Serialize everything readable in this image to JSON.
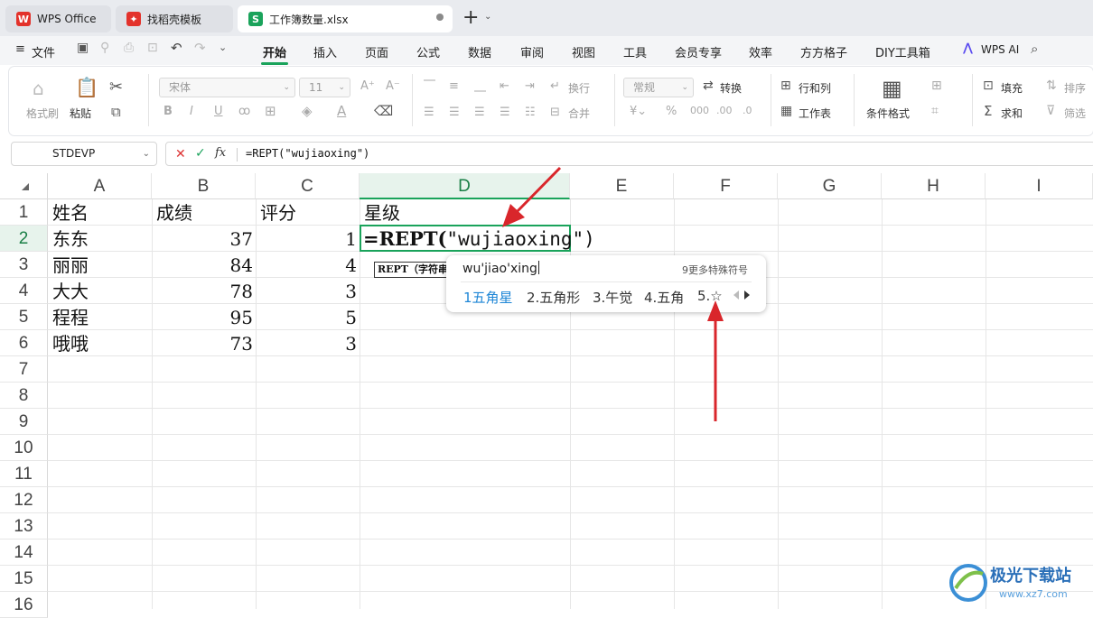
{
  "tabs": [
    {
      "label": "WPS Office"
    },
    {
      "label": "找稻壳模板"
    },
    {
      "label": "工作簿数量.xlsx"
    }
  ],
  "new_tab_label": "+",
  "menu": {
    "file": "文件",
    "items": [
      "开始",
      "插入",
      "页面",
      "公式",
      "数据",
      "审阅",
      "视图",
      "工具",
      "会员专享",
      "效率",
      "方方格子",
      "DIY工具箱"
    ],
    "ai": "WPS AI"
  },
  "ribbon": {
    "format_painter": "格式刷",
    "paste": "粘贴",
    "font_name": "宋体",
    "font_size": "11",
    "wrap": "换行",
    "merge": "合并",
    "number_format": "常规",
    "convert": "转换",
    "rows_cols": "行和列",
    "worksheet": "工作表",
    "conditional_format": "条件格式",
    "fill": "填充",
    "sort": "排序",
    "sum": "求和",
    "filter": "筛选"
  },
  "formula_bar": {
    "name_box": "STDEVP",
    "formula": "=REPT(\"wujiaoxing\")",
    "fx_label": "fx"
  },
  "columns": [
    "A",
    "B",
    "C",
    "D",
    "E",
    "F",
    "G",
    "H",
    "I"
  ],
  "rows": [
    "1",
    "2",
    "3",
    "4",
    "5",
    "6",
    "7",
    "8",
    "9",
    "10",
    "11",
    "12",
    "13",
    "14",
    "15",
    "16"
  ],
  "sheet": {
    "headers": [
      "姓名",
      "成绩",
      "评分",
      "星级"
    ],
    "data": [
      {
        "name": "东东",
        "score": "37",
        "rating": "1"
      },
      {
        "name": "丽丽",
        "score": "84",
        "rating": "4"
      },
      {
        "name": "大大",
        "score": "78",
        "rating": "3"
      },
      {
        "name": "程程",
        "score": "95",
        "rating": "5"
      },
      {
        "name": "哦哦",
        "score": "73",
        "rating": "3"
      }
    ],
    "active_cell_func": "=REPT(",
    "active_cell_arg": "\"wujiaoxing\")",
    "func_tooltip": "REPT（字符串"
  },
  "ime": {
    "pinyin": "wu'jiao'xing",
    "more": "9更多特殊符号",
    "candidates": [
      "1五角星",
      "2.五角形",
      "3.午觉",
      "4.五角",
      "5.☆"
    ]
  },
  "colors": {
    "accent": "#1aa35b",
    "annotation_arrow": "#d9262b",
    "ime_selected": "#1e86d6"
  }
}
